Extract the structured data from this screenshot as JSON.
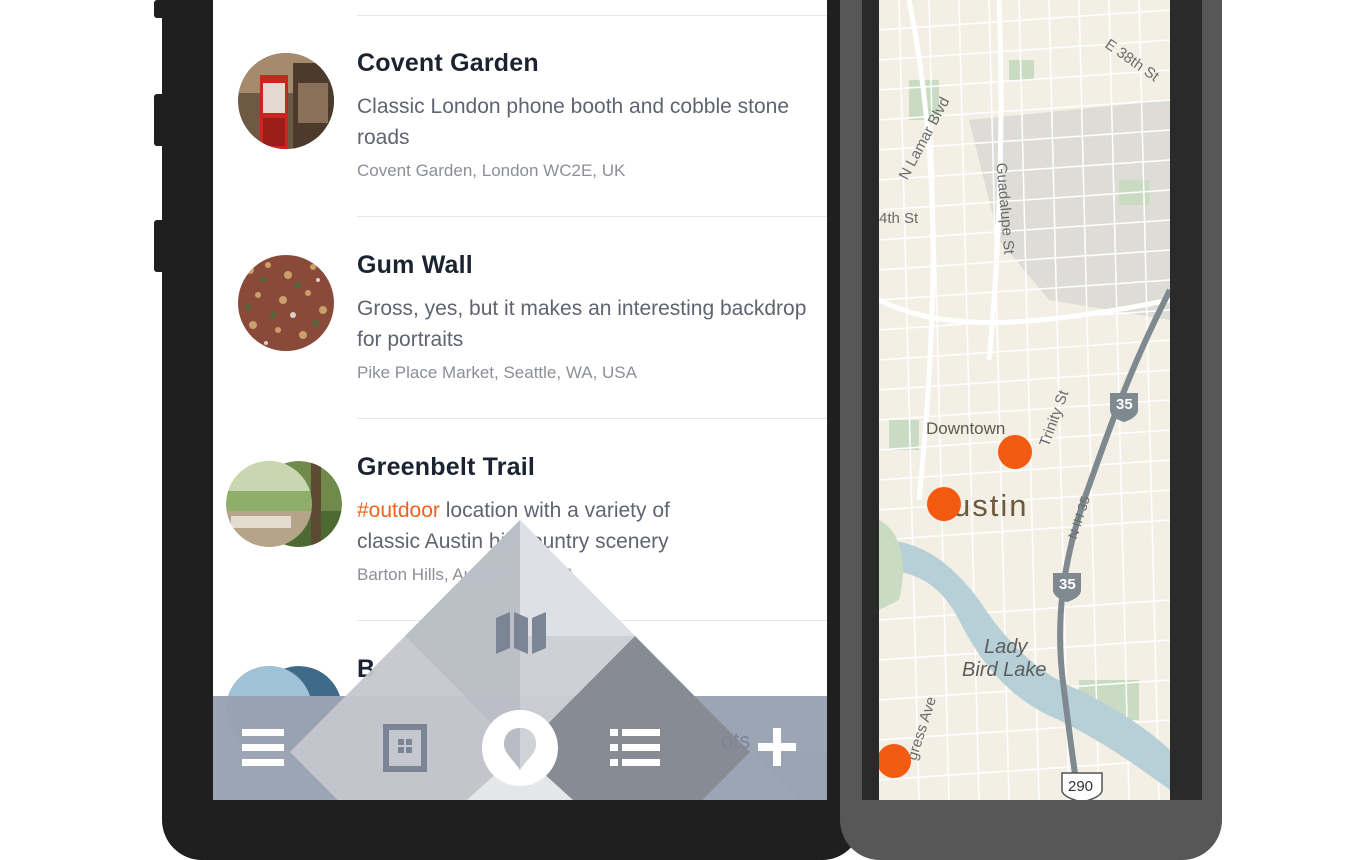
{
  "places": [
    {
      "name": "Covent Garden",
      "description": "Classic London phone booth and cobble stone roads",
      "location": "Covent Garden, London WC2E, UK"
    },
    {
      "name": "Gum Wall",
      "description": "Gross, yes, but it makes an interesting backdrop for portraits",
      "location": "Pike Place Market, Seattle, WA, USA"
    },
    {
      "name": "Greenbelt Trail",
      "tag": "#outdoor",
      "description_line1": " location with a variety of",
      "description_line2": "classic Austin hill country scenery",
      "location": "Barton Hills, Austin, TX, USA"
    },
    {
      "name": "B",
      "partial_right": "t"
    }
  ],
  "bottom_nav": {
    "menu_icon": "hamburger-menu-icon",
    "board_icon": "board-icon",
    "pin_icon": "location-pin-icon",
    "list_icon": "list-icon",
    "add_icon": "plus-icon",
    "map_icon": "map-icon",
    "partial_text": "ots"
  },
  "map": {
    "labels": {
      "street_38th": "E 38th St",
      "lamar": "N Lamar Blvd",
      "fourth_st": "4th St",
      "guadalupe": "Guadalupe St",
      "trinity": "Trinity St",
      "downtown": "Downtown",
      "austin": "ustin",
      "ih35": "N IH 35",
      "lake_line1": "Lady",
      "lake_line2": "Bird Lake",
      "congress": "gress Ave"
    },
    "shields": {
      "i35_top": "35",
      "i35_bottom": "35",
      "us290": "290"
    }
  },
  "colors": {
    "accent": "#f2611d",
    "pin": "#f35a12",
    "bar": "#9aa3b3"
  }
}
